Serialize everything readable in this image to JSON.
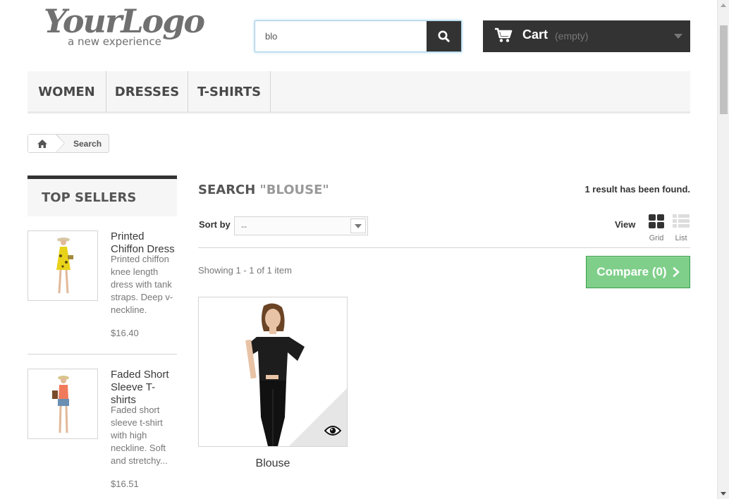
{
  "header": {
    "logo_text": "YourLogo",
    "logo_tagline": "a new experience",
    "search": {
      "value": "blo",
      "placeholder": "Search"
    },
    "cart": {
      "title": "Cart",
      "quantity": "(empty)"
    }
  },
  "nav": {
    "items": [
      {
        "label": "WOMEN"
      },
      {
        "label": "DRESSES"
      },
      {
        "label": "T-SHIRTS"
      }
    ]
  },
  "breadcrumb": {
    "current": "Search"
  },
  "sidebar": {
    "title": "TOP SELLERS",
    "products": [
      {
        "name": "Printed Chiffon Dress",
        "description": "Printed chiffon knee length dress with tank straps. Deep v-neckline.",
        "price": "$16.40"
      },
      {
        "name": "Faded Short Sleeve T-shirts",
        "description": "Faded short sleeve t-shirt with high neckline. Soft and stretchy...",
        "price": "$16.51"
      }
    ]
  },
  "main": {
    "heading": "SEARCH",
    "query": "\"BLOUSE\"",
    "results_count": "1 result has been found.",
    "sort_label": "Sort by",
    "sort_value": "--",
    "view_label": "View",
    "view_grid": "Grid",
    "view_list": "List",
    "showing": "Showing 1 - 1 of 1 item",
    "compare": "Compare (0)",
    "products": [
      {
        "name": "Blouse"
      }
    ]
  },
  "colors": {
    "dark": "#333333",
    "compare_green": "#7fcf8a",
    "nav_bg": "#f6f6f6",
    "border": "#d6d4d4"
  }
}
